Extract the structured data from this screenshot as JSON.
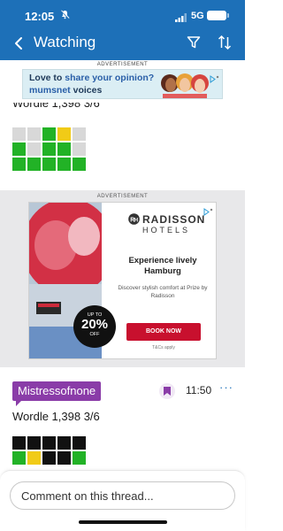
{
  "status_bar": {
    "time": "12:05",
    "network": "5G"
  },
  "nav": {
    "title": "Watching"
  },
  "ad_top": {
    "label": "ADVERTISEMENT",
    "line1_a": "Love to ",
    "line1_b": "share your opinion?",
    "line2_a": "mumsnet",
    "line2_b": " voices"
  },
  "post1": {
    "wordle_fragment": "Wordle 1,398 3/6",
    "grid": [
      [
        "l",
        "l",
        "g",
        "y",
        "l"
      ],
      [
        "g",
        "l",
        "g",
        "g",
        "l"
      ],
      [
        "g",
        "g",
        "g",
        "g",
        "g"
      ]
    ]
  },
  "ad_mid": {
    "label": "ADVERTISEMENT",
    "brand_name": "RADISSON",
    "brand_sub": "HOTELS",
    "headline": "Experience lively Hamburg",
    "subline": "Discover stylish comfort at Prize by Radisson",
    "cta": "BOOK NOW",
    "tcs": "T&Cs apply",
    "badge_top": "UP TO",
    "badge_value": "20%",
    "badge_bottom": "OFF"
  },
  "post2": {
    "username": "Mistressofnone",
    "time": "11:50",
    "more": "···",
    "wordle": "Wordle 1,398 3/6",
    "grid": [
      [
        "b",
        "b",
        "b",
        "b",
        "b"
      ],
      [
        "g",
        "y",
        "b",
        "b",
        "g"
      ]
    ]
  },
  "comment": {
    "placeholder": "Comment on this thread..."
  },
  "colors": {
    "header": "#1d70b8",
    "username_badge": "#8a3ca8",
    "wordle_green": "#22b226",
    "wordle_yellow": "#f1cb17",
    "cta_red": "#c8102e"
  },
  "icons": [
    "bell-mute-icon",
    "signal-icon",
    "battery-icon",
    "back-icon",
    "filter-icon",
    "sort-icon",
    "ad-choices-icon",
    "radisson-logo-icon",
    "bookmark-icon",
    "more-icon"
  ]
}
